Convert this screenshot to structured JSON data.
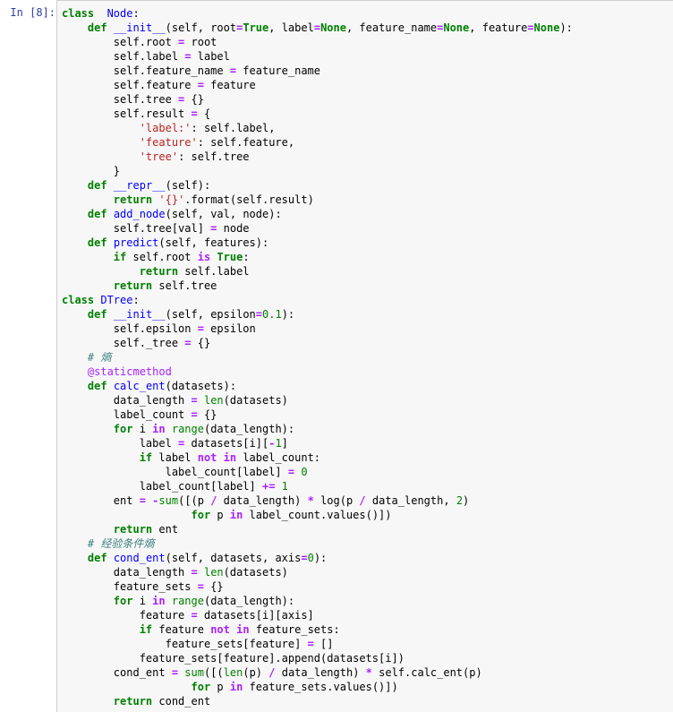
{
  "prompt": "In  [8]:",
  "lines": [
    [
      [
        "kw",
        "class"
      ],
      [
        "",
        "  "
      ],
      [
        "def",
        "Node"
      ],
      [
        "",
        ":"
      ]
    ],
    [
      [
        "",
        "    "
      ],
      [
        "kw",
        "def"
      ],
      [
        "",
        " "
      ],
      [
        "def",
        "__init__"
      ],
      [
        "",
        "(self, root"
      ],
      [
        "op",
        "="
      ],
      [
        "kw",
        "True"
      ],
      [
        "",
        ", label"
      ],
      [
        "op",
        "="
      ],
      [
        "kw",
        "None"
      ],
      [
        "",
        ", feature_name"
      ],
      [
        "op",
        "="
      ],
      [
        "kw",
        "None"
      ],
      [
        "",
        ", feature"
      ],
      [
        "op",
        "="
      ],
      [
        "kw",
        "None"
      ],
      [
        "",
        "):"
      ]
    ],
    [
      [
        "",
        "        self.root "
      ],
      [
        "op",
        "="
      ],
      [
        "",
        " root"
      ]
    ],
    [
      [
        "",
        "        self.label "
      ],
      [
        "op",
        "="
      ],
      [
        "",
        " label"
      ]
    ],
    [
      [
        "",
        "        self.feature_name "
      ],
      [
        "op",
        "="
      ],
      [
        "",
        " feature_name"
      ]
    ],
    [
      [
        "",
        "        self.feature "
      ],
      [
        "op",
        "="
      ],
      [
        "",
        " feature"
      ]
    ],
    [
      [
        "",
        "        self.tree "
      ],
      [
        "op",
        "="
      ],
      [
        "",
        " {}"
      ]
    ],
    [
      [
        "",
        "        self.result "
      ],
      [
        "op",
        "="
      ],
      [
        "",
        " {"
      ]
    ],
    [
      [
        "",
        "            "
      ],
      [
        "str",
        "'label:'"
      ],
      [
        "",
        ": self.label,"
      ]
    ],
    [
      [
        "",
        "            "
      ],
      [
        "str",
        "'feature'"
      ],
      [
        "",
        ": self.feature,"
      ]
    ],
    [
      [
        "",
        "            "
      ],
      [
        "str",
        "'tree'"
      ],
      [
        "",
        ": self.tree"
      ]
    ],
    [
      [
        "",
        "        }"
      ]
    ],
    [
      [
        "",
        "    "
      ],
      [
        "kw",
        "def"
      ],
      [
        "",
        " "
      ],
      [
        "def",
        "__repr__"
      ],
      [
        "",
        "(self):"
      ]
    ],
    [
      [
        "",
        "        "
      ],
      [
        "kw",
        "return"
      ],
      [
        "",
        " "
      ],
      [
        "str",
        "'{}'"
      ],
      [
        "",
        ".format(self.result)"
      ]
    ],
    [
      [
        "",
        "    "
      ],
      [
        "kw",
        "def"
      ],
      [
        "",
        " "
      ],
      [
        "def",
        "add_node"
      ],
      [
        "",
        "(self, val, node):"
      ]
    ],
    [
      [
        "",
        "        self.tree[val] "
      ],
      [
        "op",
        "="
      ],
      [
        "",
        " node"
      ]
    ],
    [
      [
        "",
        "    "
      ],
      [
        "kw",
        "def"
      ],
      [
        "",
        " "
      ],
      [
        "def",
        "predict"
      ],
      [
        "",
        "(self, features):"
      ]
    ],
    [
      [
        "",
        "        "
      ],
      [
        "kw",
        "if"
      ],
      [
        "",
        " self.root "
      ],
      [
        "op",
        "is"
      ],
      [
        "",
        " "
      ],
      [
        "kw",
        "True"
      ],
      [
        "",
        ":"
      ]
    ],
    [
      [
        "",
        "            "
      ],
      [
        "kw",
        "return"
      ],
      [
        "",
        " self.label"
      ]
    ],
    [
      [
        "",
        "        "
      ],
      [
        "kw",
        "return"
      ],
      [
        "",
        " self.tree"
      ]
    ],
    [
      [
        "kw",
        "class"
      ],
      [
        "",
        " "
      ],
      [
        "def",
        "DTree"
      ],
      [
        "",
        ":"
      ]
    ],
    [
      [
        "",
        "    "
      ],
      [
        "kw",
        "def"
      ],
      [
        "",
        " "
      ],
      [
        "def",
        "__init__"
      ],
      [
        "",
        "(self, epsilon"
      ],
      [
        "op",
        "="
      ],
      [
        "num",
        "0.1"
      ],
      [
        "",
        "):"
      ]
    ],
    [
      [
        "",
        "        self.epsilon "
      ],
      [
        "op",
        "="
      ],
      [
        "",
        " epsilon"
      ]
    ],
    [
      [
        "",
        "        self._tree "
      ],
      [
        "op",
        "="
      ],
      [
        "",
        " {}"
      ]
    ],
    [
      [
        "",
        "    "
      ],
      [
        "cmt",
        "# 熵"
      ]
    ],
    [
      [
        "",
        "    "
      ],
      [
        "deco",
        "@staticmethod"
      ]
    ],
    [
      [
        "",
        "    "
      ],
      [
        "kw",
        "def"
      ],
      [
        "",
        " "
      ],
      [
        "def",
        "calc_ent"
      ],
      [
        "",
        "(datasets):"
      ]
    ],
    [
      [
        "",
        "        data_length "
      ],
      [
        "op",
        "="
      ],
      [
        "",
        " "
      ],
      [
        "bi",
        "len"
      ],
      [
        "",
        "(datasets)"
      ]
    ],
    [
      [
        "",
        "        label_count "
      ],
      [
        "op",
        "="
      ],
      [
        "",
        " {}"
      ]
    ],
    [
      [
        "",
        "        "
      ],
      [
        "kw",
        "for"
      ],
      [
        "",
        " i "
      ],
      [
        "op",
        "in"
      ],
      [
        "",
        " "
      ],
      [
        "bi",
        "range"
      ],
      [
        "",
        "(data_length):"
      ]
    ],
    [
      [
        "",
        "            label "
      ],
      [
        "op",
        "="
      ],
      [
        "",
        " datasets[i]["
      ],
      [
        "op",
        "-"
      ],
      [
        "num",
        "1"
      ],
      [
        "",
        "]"
      ]
    ],
    [
      [
        "",
        "            "
      ],
      [
        "kw",
        "if"
      ],
      [
        "",
        " label "
      ],
      [
        "op",
        "not"
      ],
      [
        "",
        " "
      ],
      [
        "op",
        "in"
      ],
      [
        "",
        " label_count:"
      ]
    ],
    [
      [
        "",
        "                label_count[label] "
      ],
      [
        "op",
        "="
      ],
      [
        "",
        " "
      ],
      [
        "num",
        "0"
      ]
    ],
    [
      [
        "",
        "            label_count[label] "
      ],
      [
        "op",
        "+="
      ],
      [
        "",
        " "
      ],
      [
        "num",
        "1"
      ]
    ],
    [
      [
        "",
        "        ent "
      ],
      [
        "op",
        "="
      ],
      [
        "",
        " "
      ],
      [
        "op",
        "-"
      ],
      [
        "bi",
        "sum"
      ],
      [
        "",
        "([(p "
      ],
      [
        "op",
        "/"
      ],
      [
        "",
        " data_length) "
      ],
      [
        "op",
        "*"
      ],
      [
        "",
        " log(p "
      ],
      [
        "op",
        "/"
      ],
      [
        "",
        " data_length, "
      ],
      [
        "num",
        "2"
      ],
      [
        "",
        ")"
      ]
    ],
    [
      [
        "",
        "                    "
      ],
      [
        "kw",
        "for"
      ],
      [
        "",
        " p "
      ],
      [
        "op",
        "in"
      ],
      [
        "",
        " label_count.values()])"
      ]
    ],
    [
      [
        "",
        "        "
      ],
      [
        "kw",
        "return"
      ],
      [
        "",
        " ent"
      ]
    ],
    [
      [
        "",
        "    "
      ],
      [
        "cmt",
        "# 经验条件熵"
      ]
    ],
    [
      [
        "",
        "    "
      ],
      [
        "kw",
        "def"
      ],
      [
        "",
        " "
      ],
      [
        "def",
        "cond_ent"
      ],
      [
        "",
        "(self, datasets, axis"
      ],
      [
        "op",
        "="
      ],
      [
        "num",
        "0"
      ],
      [
        "",
        "):"
      ]
    ],
    [
      [
        "",
        "        data_length "
      ],
      [
        "op",
        "="
      ],
      [
        "",
        " "
      ],
      [
        "bi",
        "len"
      ],
      [
        "",
        "(datasets)"
      ]
    ],
    [
      [
        "",
        "        feature_sets "
      ],
      [
        "op",
        "="
      ],
      [
        "",
        " {}"
      ]
    ],
    [
      [
        "",
        "        "
      ],
      [
        "kw",
        "for"
      ],
      [
        "",
        " i "
      ],
      [
        "op",
        "in"
      ],
      [
        "",
        " "
      ],
      [
        "bi",
        "range"
      ],
      [
        "",
        "(data_length):"
      ]
    ],
    [
      [
        "",
        "            feature "
      ],
      [
        "op",
        "="
      ],
      [
        "",
        " datasets[i][axis]"
      ]
    ],
    [
      [
        "",
        "            "
      ],
      [
        "kw",
        "if"
      ],
      [
        "",
        " feature "
      ],
      [
        "op",
        "not"
      ],
      [
        "",
        " "
      ],
      [
        "op",
        "in"
      ],
      [
        "",
        " feature_sets:"
      ]
    ],
    [
      [
        "",
        "                feature_sets[feature] "
      ],
      [
        "op",
        "="
      ],
      [
        "",
        " []"
      ]
    ],
    [
      [
        "",
        "            feature_sets[feature].append(datasets[i])"
      ]
    ],
    [
      [
        "",
        "        cond_ent "
      ],
      [
        "op",
        "="
      ],
      [
        "",
        " "
      ],
      [
        "bi",
        "sum"
      ],
      [
        "",
        "([("
      ],
      [
        "bi",
        "len"
      ],
      [
        "",
        "(p) "
      ],
      [
        "op",
        "/"
      ],
      [
        "",
        " data_length) "
      ],
      [
        "op",
        "*"
      ],
      [
        "",
        " self.calc_ent(p)"
      ]
    ],
    [
      [
        "",
        "                    "
      ],
      [
        "kw",
        "for"
      ],
      [
        "",
        " p "
      ],
      [
        "op",
        "in"
      ],
      [
        "",
        " feature_sets.values()])"
      ]
    ],
    [
      [
        "",
        "        "
      ],
      [
        "kw",
        "return"
      ],
      [
        "",
        " cond_ent"
      ]
    ]
  ]
}
